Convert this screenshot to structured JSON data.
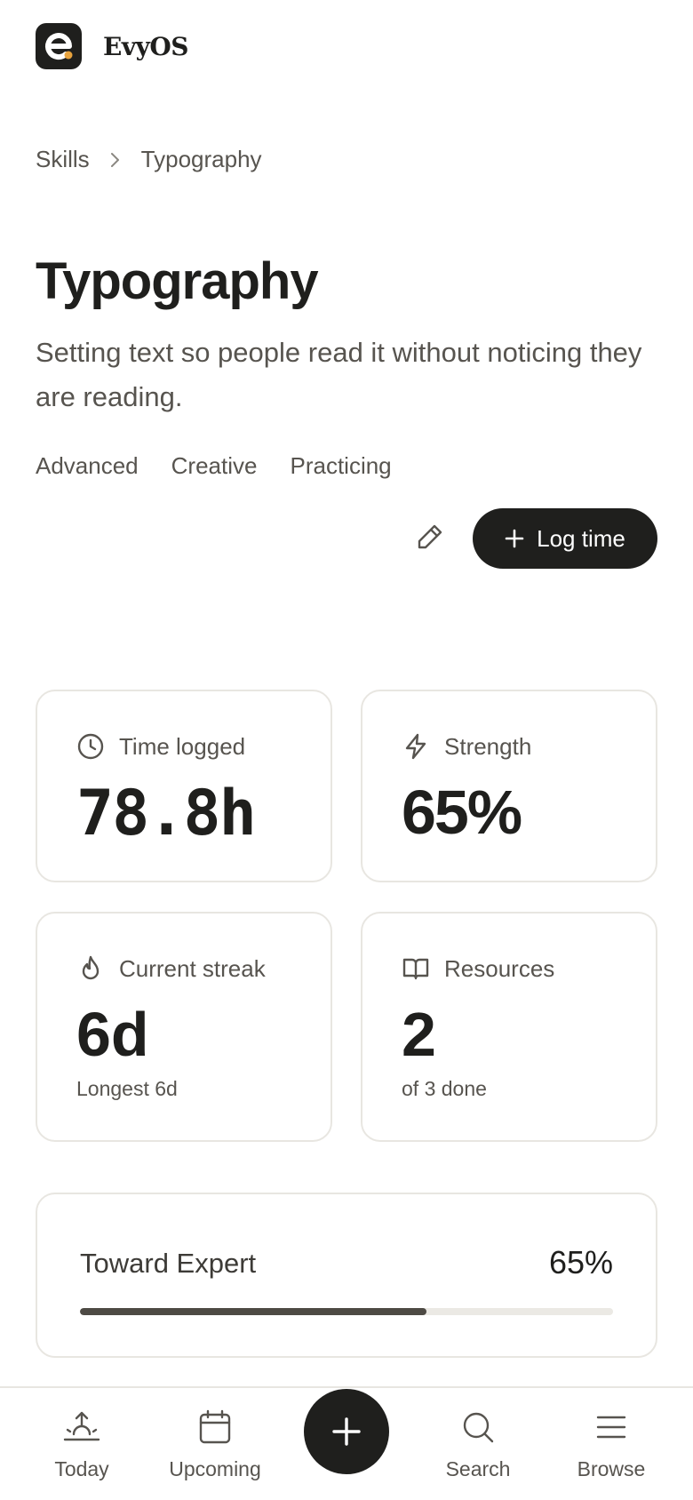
{
  "app": {
    "name": "EvyOS"
  },
  "breadcrumb": {
    "parent": "Skills",
    "current": "Typography"
  },
  "skill": {
    "title": "Typography",
    "description": "Setting text so people read it without noticing they are reading.",
    "tags": [
      "Advanced",
      "Creative",
      "Practicing"
    ]
  },
  "actions": {
    "log_time_label": "Log time"
  },
  "stats": {
    "time_logged": {
      "label": "Time logged",
      "value": "78.8h"
    },
    "strength": {
      "label": "Strength",
      "value": "65%"
    },
    "streak": {
      "label": "Current streak",
      "value": "6d",
      "sub": "Longest 6d"
    },
    "resources": {
      "label": "Resources",
      "value": "2",
      "sub": "of 3 done"
    }
  },
  "progress": {
    "label": "Toward Expert",
    "percent_text": "65%",
    "percent": 65
  },
  "nav": {
    "today": "Today",
    "upcoming": "Upcoming",
    "search": "Search",
    "browse": "Browse"
  },
  "colors": {
    "primary": "#1f1f1d",
    "accent": "#e8a33d",
    "muted": "#57544f",
    "border": "#e8e6e1"
  }
}
